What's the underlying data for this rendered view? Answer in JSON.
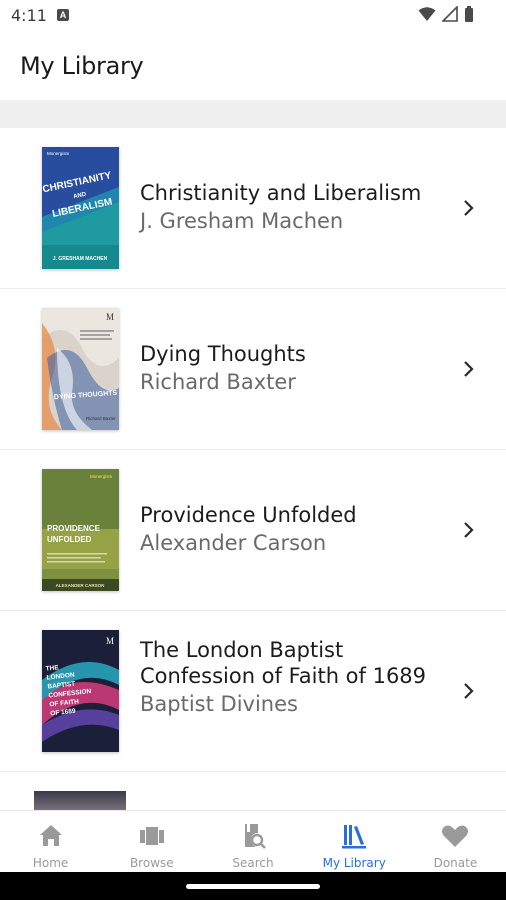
{
  "status_bar": {
    "time": "4:11",
    "app_icon": "A",
    "icons": [
      "wifi-icon",
      "signal-icon",
      "battery-icon"
    ]
  },
  "header": {
    "title": "My Library"
  },
  "books": [
    {
      "title": "Christianity and Liberalism",
      "author": "J. Gresham Machen",
      "cover": {
        "publisher": "Monergism",
        "line1": "CHRISTIANITY",
        "line2": "AND",
        "line3": "LIBERALISM",
        "author_caps": "J. GRESHAM MACHEN",
        "bg": "#1e9aa0",
        "accent": "#2b3f9e"
      }
    },
    {
      "title": "Dying Thoughts",
      "author": "Richard Baxter",
      "cover": {
        "logo": "M",
        "line1": "DYING THOUGHTS",
        "author_small": "Richard Baxter",
        "bg": "#e9e2dc",
        "accent": "#2e4a82"
      }
    },
    {
      "title": "Providence Unfolded",
      "author": "Alexander Carson",
      "cover": {
        "publisher": "Monergism",
        "line1": "PROVIDENCE",
        "line2": "UNFOLDED",
        "author_caps": "ALEXANDER CARSON",
        "bg": "#7a8c3c",
        "accent": "#c7c24a"
      }
    },
    {
      "title": "The London Baptist Confession of Faith of 1689",
      "author": "Baptist Divines",
      "cover": {
        "logo": "M",
        "line1": "THE",
        "line2": "LONDON",
        "line3": "BAPTIST",
        "line4": "CONFESSION",
        "line5": "OF FAITH",
        "line6": "OF 1689",
        "bg": "#1c1f3a",
        "accent": "#d63e7e"
      }
    }
  ],
  "bottom_nav": {
    "items": [
      {
        "label": "Home",
        "icon": "home-icon"
      },
      {
        "label": "Browse",
        "icon": "browse-icon"
      },
      {
        "label": "Search",
        "icon": "search-icon"
      },
      {
        "label": "My Library",
        "icon": "library-icon",
        "active": true
      },
      {
        "label": "Donate",
        "icon": "heart-icon"
      }
    ],
    "active_color": "#2a6edb",
    "inactive_color": "#9a9a9a"
  }
}
